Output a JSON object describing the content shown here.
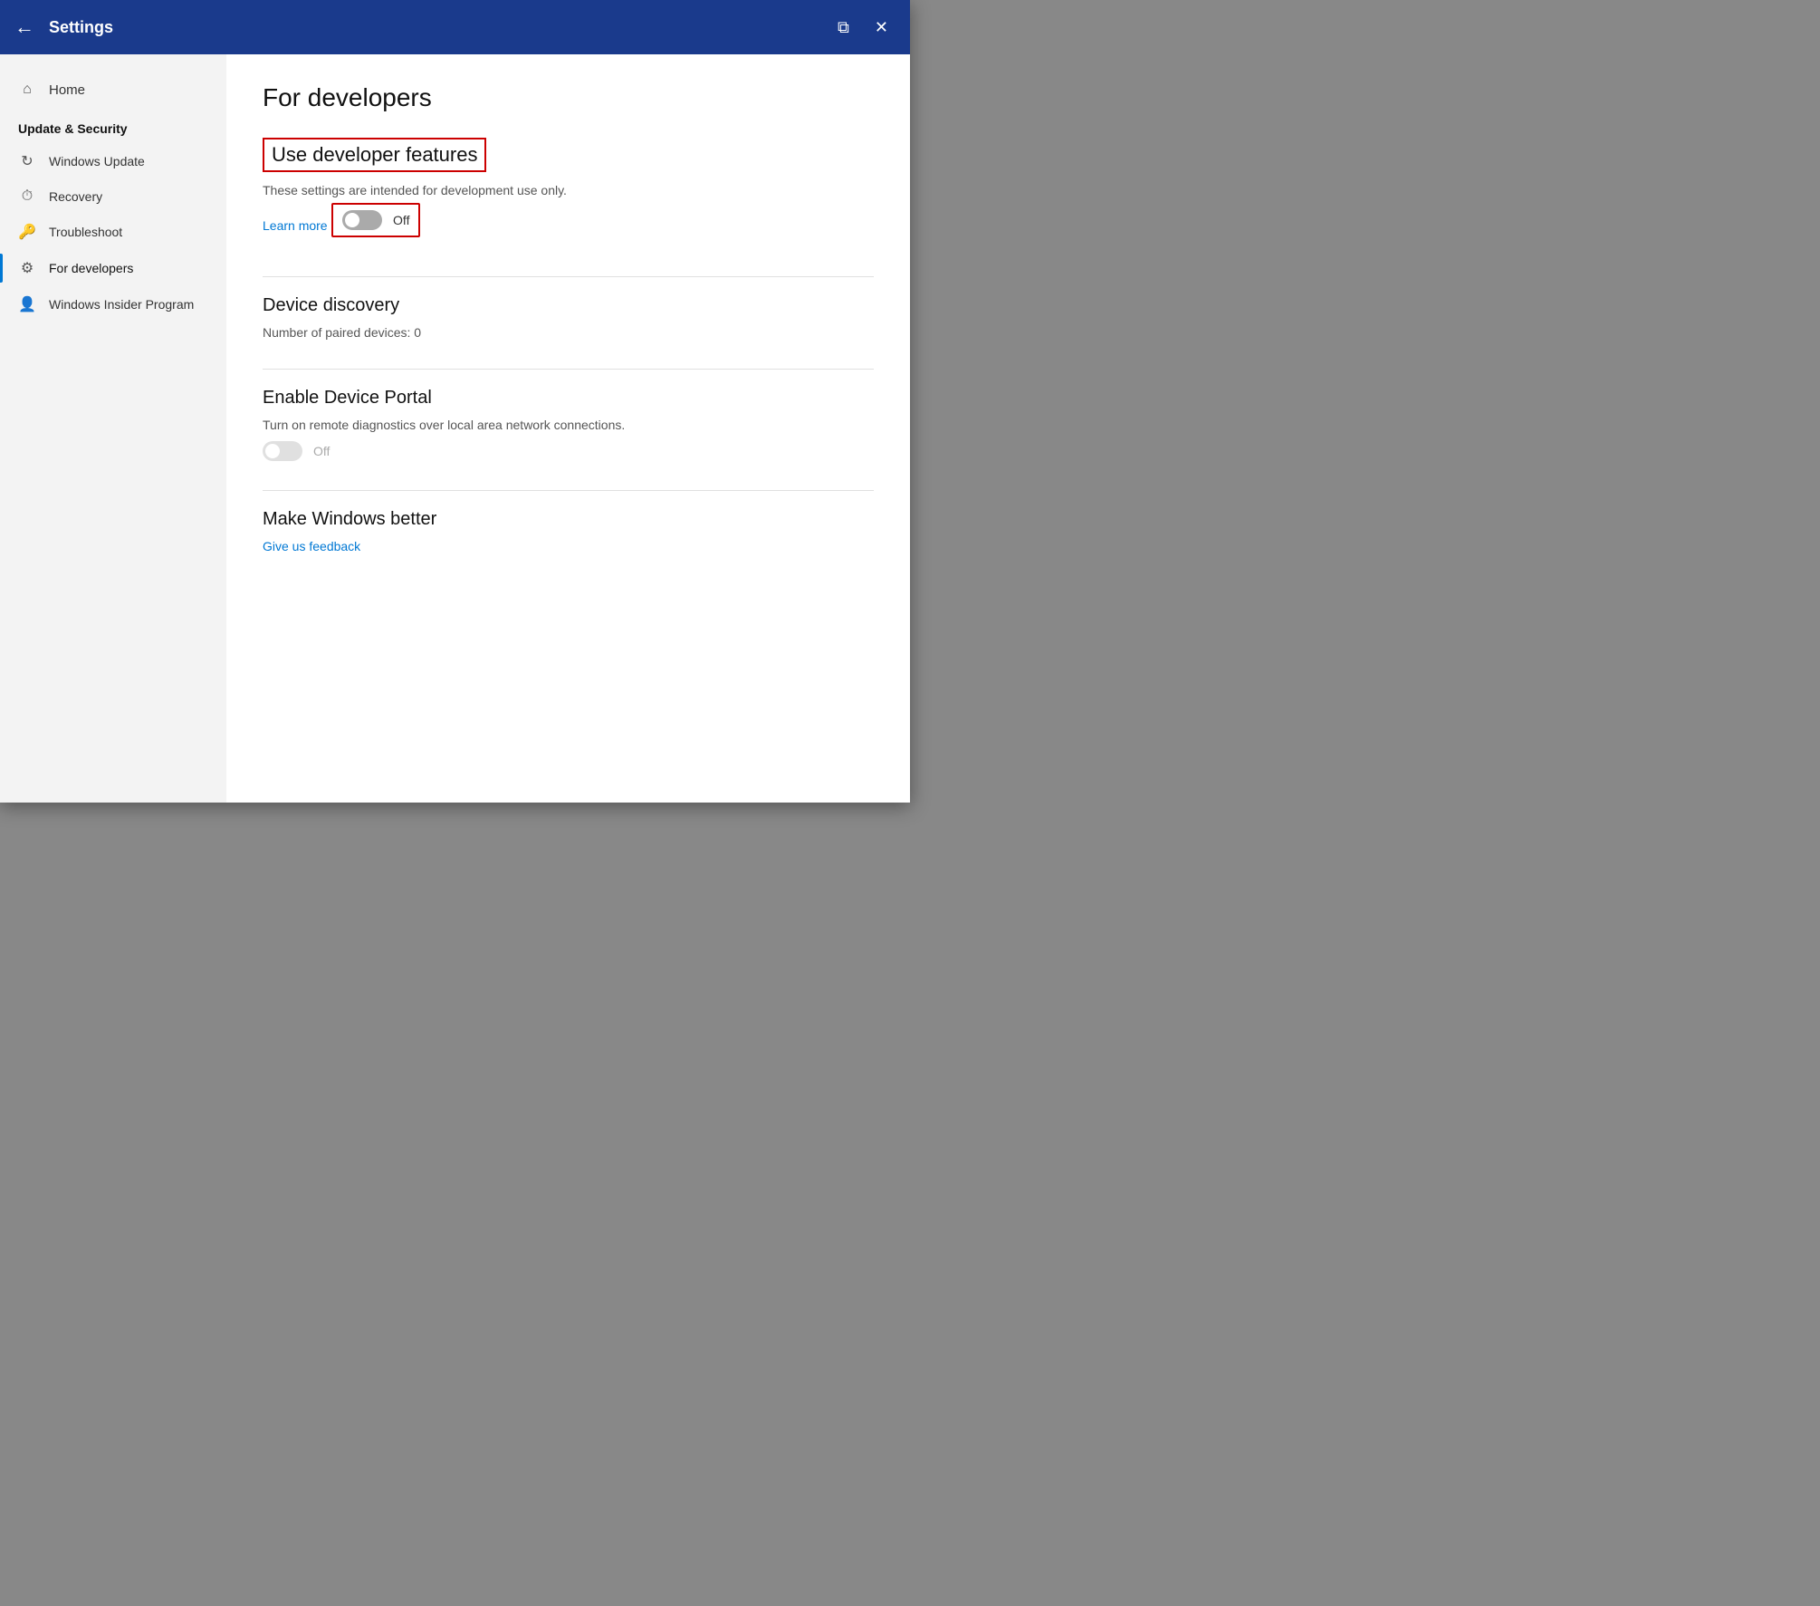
{
  "titlebar": {
    "title": "Settings",
    "back_label": "←",
    "snap_icon": "⧉",
    "close_icon": "✕"
  },
  "sidebar": {
    "home_label": "Home",
    "section_title": "Update & Security",
    "items": [
      {
        "id": "windows-update",
        "label": "Windows Update",
        "icon": "↻"
      },
      {
        "id": "recovery",
        "label": "Recovery",
        "icon": "⏱"
      },
      {
        "id": "troubleshoot",
        "label": "Troubleshoot",
        "icon": "🔑"
      },
      {
        "id": "for-developers",
        "label": "For developers",
        "icon": "⚙",
        "active": true
      },
      {
        "id": "windows-insider",
        "label": "Windows Insider Program",
        "icon": "👤"
      }
    ]
  },
  "content": {
    "page_title": "For developers",
    "use_developer_features": {
      "section_title": "Use developer features",
      "description": "These settings are intended for development use only.",
      "learn_more_label": "Learn more",
      "toggle_state": "Off",
      "toggle_on": false
    },
    "device_discovery": {
      "section_title": "Device discovery",
      "paired_devices_label": "Number of paired devices: 0"
    },
    "enable_device_portal": {
      "section_title": "Enable Device Portal",
      "description": "Turn on remote diagnostics over local area network connections.",
      "toggle_state": "Off",
      "toggle_on": false
    },
    "make_windows_better": {
      "section_title": "Make Windows better",
      "feedback_link_label": "Give us feedback"
    }
  }
}
